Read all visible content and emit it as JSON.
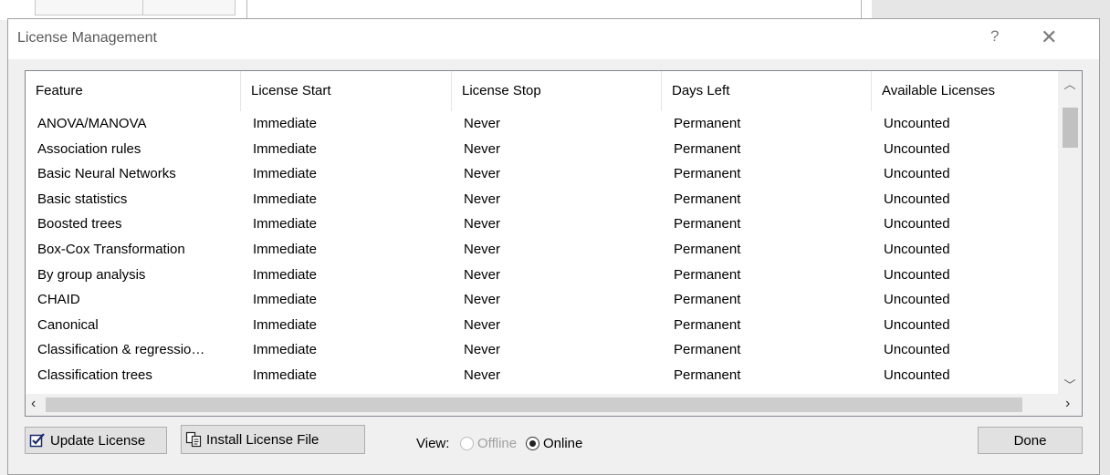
{
  "dialog": {
    "title": "License Management",
    "help_label": "?",
    "close_label": "✕"
  },
  "table": {
    "columns": [
      "Feature",
      "License Start",
      "License Stop",
      "Days Left",
      "Available Licenses"
    ],
    "rows": [
      [
        "ANOVA/MANOVA",
        "Immediate",
        "Never",
        "Permanent",
        "Uncounted"
      ],
      [
        "Association rules",
        "Immediate",
        "Never",
        "Permanent",
        "Uncounted"
      ],
      [
        "Basic Neural Networks",
        "Immediate",
        "Never",
        "Permanent",
        "Uncounted"
      ],
      [
        "Basic statistics",
        "Immediate",
        "Never",
        "Permanent",
        "Uncounted"
      ],
      [
        "Boosted trees",
        "Immediate",
        "Never",
        "Permanent",
        "Uncounted"
      ],
      [
        "Box-Cox Transformation",
        "Immediate",
        "Never",
        "Permanent",
        "Uncounted"
      ],
      [
        "By group analysis",
        "Immediate",
        "Never",
        "Permanent",
        "Uncounted"
      ],
      [
        "CHAID",
        "Immediate",
        "Never",
        "Permanent",
        "Uncounted"
      ],
      [
        "Canonical",
        "Immediate",
        "Never",
        "Permanent",
        "Uncounted"
      ],
      [
        "Classification & regressio…",
        "Immediate",
        "Never",
        "Permanent",
        "Uncounted"
      ],
      [
        "Classification trees",
        "Immediate",
        "Never",
        "Permanent",
        "Uncounted"
      ]
    ]
  },
  "footer": {
    "update_license_label": "Update License",
    "install_license_label": "Install License File",
    "view_label": "View:",
    "offline_label": "Offline",
    "online_label": "Online",
    "selected_view": "Online",
    "done_label": "Done"
  },
  "icons": {
    "update_license": "checkbox-edit-icon",
    "install_license": "copy-document-icon"
  }
}
